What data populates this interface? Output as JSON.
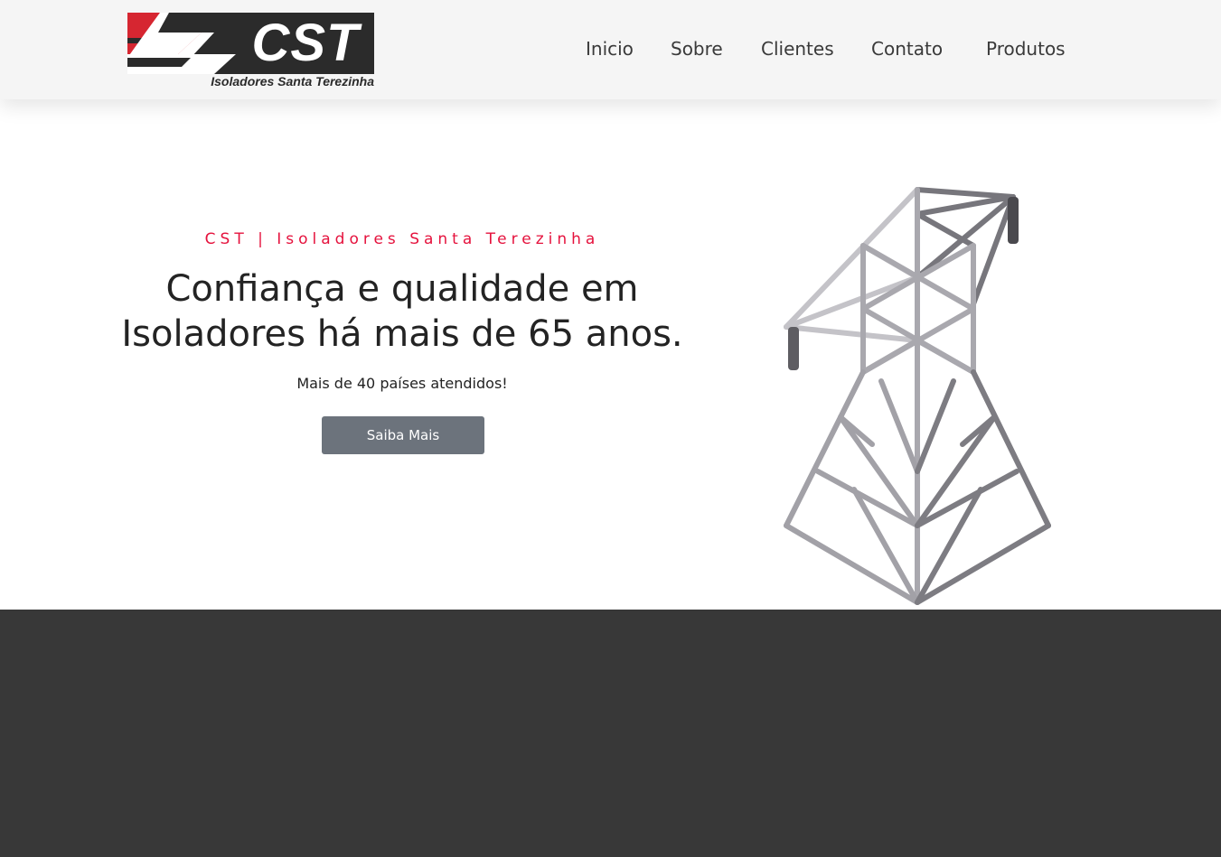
{
  "brand": {
    "logo_text": "CST",
    "logo_tagline": "Isoladores Santa Terezinha",
    "colors": {
      "red": "#d62631",
      "dark": "#2b2b2b"
    }
  },
  "nav": {
    "items": [
      {
        "label": "Inicio"
      },
      {
        "label": "Sobre"
      },
      {
        "label": "Clientes"
      },
      {
        "label": "Contato"
      },
      {
        "label": "Produtos"
      }
    ]
  },
  "hero": {
    "eyebrow": "CST | Isoladores Santa Terezinha",
    "headline_line1": "Confiança e qualidade em",
    "headline_line2": "Isoladores há mais de 65 anos.",
    "subline": "Mais de 40 países atendidos!",
    "cta_label": "Saiba Mais",
    "accent_color": "#e5123d",
    "button_color": "#6c737c",
    "illustration_icon": "transmission-tower-icon"
  },
  "footer_band": {
    "color": "#383838"
  }
}
